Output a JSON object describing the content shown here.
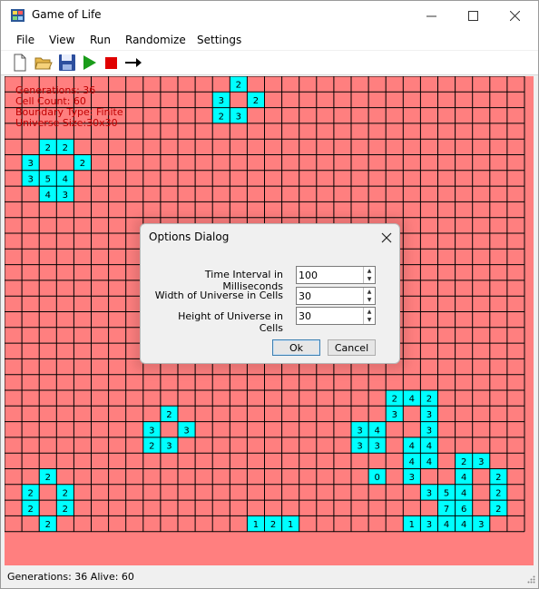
{
  "window": {
    "title": "Game of Life"
  },
  "menu": [
    "File",
    "View",
    "Run",
    "Randomize",
    "Settings"
  ],
  "toolbar": {
    "buttons": [
      {
        "name": "new-file-icon",
        "icon": "new-document"
      },
      {
        "name": "open-folder-icon",
        "icon": "folder-open"
      },
      {
        "name": "save-icon",
        "icon": "floppy-disk"
      },
      {
        "name": "play-icon",
        "icon": "play",
        "color": "#1a9c1a"
      },
      {
        "name": "stop-icon",
        "icon": "stop",
        "color": "#e00000"
      },
      {
        "name": "step-arrow-icon",
        "icon": "arrow-right"
      }
    ]
  },
  "hud": {
    "generations": "Generations: 36",
    "cell_count": "Cell Count: 60",
    "boundary": "Boundary Type: Finite",
    "universe_size": "Universe Size:30x30"
  },
  "universe": {
    "cols": 30,
    "rows": 27,
    "dead_color": "#ff7f7f",
    "alive_color": "#00ffff",
    "grid_color": "#000000",
    "cells": [
      [
        13,
        0,
        "2"
      ],
      [
        12,
        1,
        "3"
      ],
      [
        14,
        1,
        "2"
      ],
      [
        12,
        2,
        "2"
      ],
      [
        13,
        2,
        "3"
      ],
      [
        2,
        4,
        "2"
      ],
      [
        3,
        4,
        "2"
      ],
      [
        1,
        5,
        "3"
      ],
      [
        4,
        5,
        "2"
      ],
      [
        1,
        6,
        "3"
      ],
      [
        2,
        6,
        "5"
      ],
      [
        3,
        6,
        "4"
      ],
      [
        2,
        7,
        "4"
      ],
      [
        3,
        7,
        "3"
      ],
      [
        22,
        20,
        "2"
      ],
      [
        23,
        20,
        "4"
      ],
      [
        24,
        20,
        "2"
      ],
      [
        9,
        21,
        "2"
      ],
      [
        22,
        21,
        "3"
      ],
      [
        24,
        21,
        "3"
      ],
      [
        8,
        22,
        "3"
      ],
      [
        10,
        22,
        "3"
      ],
      [
        20,
        22,
        "3"
      ],
      [
        21,
        22,
        "4"
      ],
      [
        24,
        22,
        "3"
      ],
      [
        8,
        23,
        "2"
      ],
      [
        9,
        23,
        "3"
      ],
      [
        20,
        23,
        "3"
      ],
      [
        21,
        23,
        "3"
      ],
      [
        23,
        23,
        "4"
      ],
      [
        24,
        23,
        "4"
      ],
      [
        23,
        24,
        "4"
      ],
      [
        24,
        24,
        "4"
      ],
      [
        26,
        24,
        "2"
      ],
      [
        27,
        24,
        "3"
      ],
      [
        2,
        25,
        "2"
      ],
      [
        21,
        25,
        "0"
      ],
      [
        23,
        25,
        "3"
      ],
      [
        26,
        25,
        "4"
      ],
      [
        28,
        25,
        "2"
      ],
      [
        1,
        26,
        "2"
      ],
      [
        3,
        26,
        "2"
      ],
      [
        24,
        26,
        "3"
      ],
      [
        25,
        26,
        "5"
      ],
      [
        26,
        26,
        "4"
      ],
      [
        28,
        26,
        "2"
      ],
      [
        1,
        27,
        "2"
      ],
      [
        3,
        27,
        "2"
      ],
      [
        25,
        27,
        "7"
      ],
      [
        26,
        27,
        "6"
      ],
      [
        28,
        27,
        "2"
      ],
      [
        2,
        28,
        "2"
      ],
      [
        14,
        28,
        "1"
      ],
      [
        15,
        28,
        "2"
      ],
      [
        16,
        28,
        "1"
      ],
      [
        23,
        28,
        "1"
      ],
      [
        24,
        28,
        "3"
      ],
      [
        25,
        28,
        "4"
      ],
      [
        26,
        28,
        "4"
      ],
      [
        27,
        28,
        "3"
      ]
    ]
  },
  "dialog": {
    "title": "Options Dialog",
    "fields": [
      {
        "label": "Time Interval in Milliseconds",
        "value": "100"
      },
      {
        "label": "Width of Universe in Cells",
        "value": "30"
      },
      {
        "label": "Height of Universe in Cells",
        "value": "30"
      }
    ],
    "ok_label": "Ok",
    "cancel_label": "Cancel"
  },
  "status": {
    "text": "Generations: 36 Alive: 60"
  }
}
